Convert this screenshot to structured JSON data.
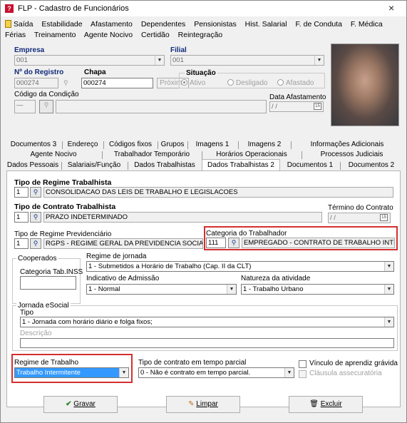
{
  "window": {
    "title": "FLP - Cadastro de Funcionários",
    "close": "×"
  },
  "menu1": [
    "Saída",
    "Estabilidade",
    "Afastamento",
    "Dependentes",
    "Pensionistas",
    "Hist. Salarial",
    "F. de Conduta",
    "F. Médica"
  ],
  "menu2": [
    "Férias",
    "Treinamento",
    "Agente Nocivo",
    "Certidão",
    "Reintegração"
  ],
  "header": {
    "empresa_label": "Empresa",
    "empresa_value": "001",
    "filial_label": "Filial",
    "filial_value": "001",
    "registro_label": "Nº do Registro",
    "registro_value": "000274",
    "chapa_label": "Chapa",
    "chapa_value": "000274",
    "proximo_label": "Próximo",
    "situacao_label": "Situação",
    "situacao_options": [
      "Ativo",
      "Desligado",
      "Afastado"
    ],
    "situacao_selected": "Ativo",
    "condicao_label": "Código da Condição",
    "condicao_value": "",
    "data_afast_label": "Data Afastamento",
    "data_afast_value": "/ /"
  },
  "tabs_row1": [
    "Documentos 3",
    "Endereço",
    "Códigos fixos",
    "Grupos",
    "Imagens 1",
    "Imagens 2",
    "Informações Adicionais"
  ],
  "tabs_row2": [
    "Agente Nocivo",
    "Trabalhador Temporário",
    "Horários Operacionais",
    "Processos Judiciais"
  ],
  "tabs_row3": [
    "Dados Pessoais",
    "Salariais/Função",
    "Dados Trabalhistas",
    "Dados Trabalhistas 2",
    "Documentos 1",
    "Documentos 2"
  ],
  "active_tab": "Dados Trabalhistas 2",
  "form": {
    "regime_trab_label": "Tipo de Regime Trabalhista",
    "regime_trab_code": "1",
    "regime_trab_desc": "CONSOLIDACAO DAS LEIS DE TRABALHO E LEGISLACOES",
    "contrato_label": "Tipo de Contrato Trabalhista",
    "contrato_code": "1",
    "contrato_desc": "PRAZO INDETERMINADO",
    "termino_label": "Término do Contrato",
    "termino_value": "/ /",
    "prev_label": "Tipo de Regime Previdenciário",
    "prev_code": "1",
    "prev_desc": "RGPS - REGIME GERAL DA PREVIDENCIA SOCIA",
    "categoria_label": "Categoria do Trabalhador",
    "categoria_code": "111",
    "categoria_desc": "EMPREGADO - CONTRATO DE TRABALHO INTE",
    "cooperados_label": "Cooperados",
    "categoria_inss_label": "Categoria Tab.INSS",
    "categoria_inss_value": "",
    "jornada_label": "Regime de jornada",
    "jornada_value": "1 - Submetidos a Horário de Trabalho (Cap. II da CLT)",
    "admissao_label": "Indicativo de Admissão",
    "admissao_value": "1 - Normal",
    "natureza_label": "Natureza da atividade",
    "natureza_value": "1 - Trabalho Urbano",
    "esocial_label": "Jornada eSocial",
    "tipo_label": "Tipo",
    "tipo_value": "1 - Jornada com horário diário e folga fixos;",
    "descricao_label": "Descrição",
    "descricao_value": "",
    "regime_label": "Regime de Trabalho",
    "regime_value": "Trabalho Intermitente",
    "parcial_label": "Tipo de contrato em tempo parcial",
    "parcial_value": "0 - Não é contrato em tempo parcial.",
    "aprendiz_label": "Vínculo de aprendiz grávida",
    "clausula_label": "Cláusula assecuratória"
  },
  "buttons": {
    "gravar": "Gravar",
    "limpar": "Limpar",
    "excluir": "Excluir"
  },
  "colors": {
    "highlight": "#d32f2f",
    "selection": "#3399ff",
    "label_blue": "#102a7a"
  }
}
